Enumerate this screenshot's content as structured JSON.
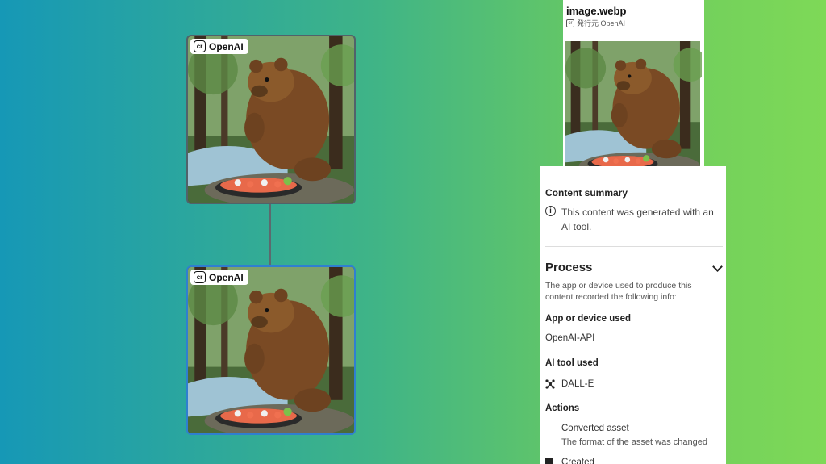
{
  "thumbnails": {
    "badge_label": "OpenAI",
    "badge_icon": "content-credentials-icon"
  },
  "card": {
    "file_name": "image.webp",
    "issuer_label": "発行元 OpenAI"
  },
  "panel": {
    "summary_heading": "Content summary",
    "summary_text": "This content was generated with an AI tool.",
    "process_heading": "Process",
    "process_desc": "The app or device used to produce this content recorded the following info:",
    "app_heading": "App or device used",
    "app_value": "OpenAI-API",
    "ai_heading": "AI tool used",
    "ai_value": "DALL-E",
    "actions_heading": "Actions",
    "action1_title": "Converted asset",
    "action1_desc": "The format of the asset was changed",
    "action2_title": "Created"
  },
  "colors": {
    "gradient_start": "#1698b6",
    "gradient_end": "#7ed957",
    "selected_border": "#2f7fd0"
  }
}
